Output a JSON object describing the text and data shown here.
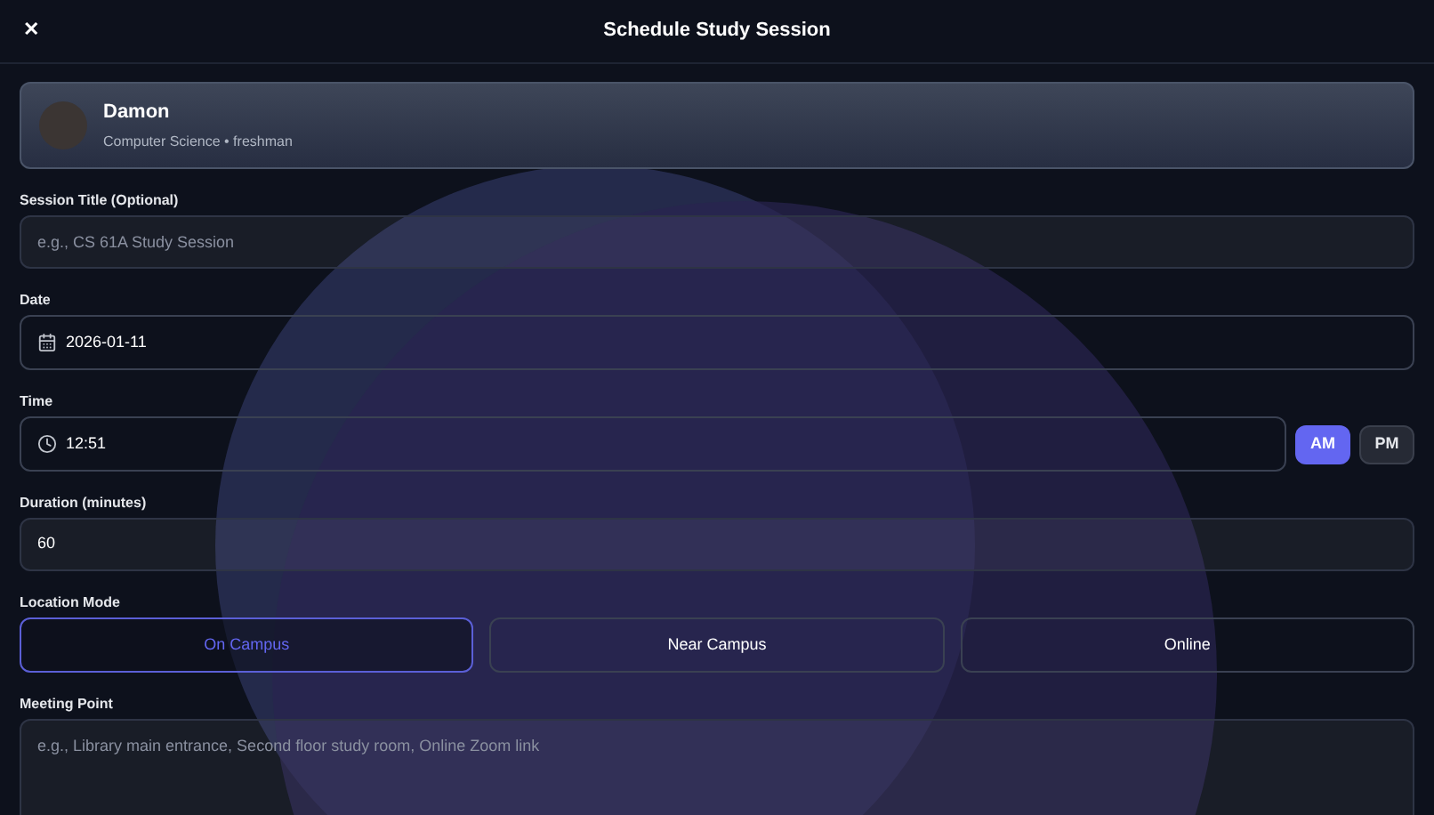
{
  "header": {
    "close": "✕",
    "title": "Schedule Study Session"
  },
  "profile": {
    "name": "Damon",
    "subtitle": "Computer Science • freshman"
  },
  "session_title": {
    "label": "Session Title (Optional)",
    "placeholder": "e.g., CS 61A Study Session"
  },
  "date": {
    "label": "Date",
    "value": "2026-01-11"
  },
  "time": {
    "label": "Time",
    "value": "12:51",
    "periods": [
      {
        "label": "AM",
        "selected": true
      },
      {
        "label": "PM",
        "selected": false
      }
    ]
  },
  "duration": {
    "label": "Duration (minutes)",
    "value": "60"
  },
  "location_mode": {
    "label": "Location Mode",
    "options": [
      {
        "label": "On Campus",
        "selected": true
      },
      {
        "label": "Near Campus",
        "selected": false
      },
      {
        "label": "Online",
        "selected": false
      }
    ]
  },
  "meeting_point": {
    "label": "Meeting Point",
    "placeholder": "e.g., Library main entrance, Second floor study room, Online Zoom link"
  }
}
